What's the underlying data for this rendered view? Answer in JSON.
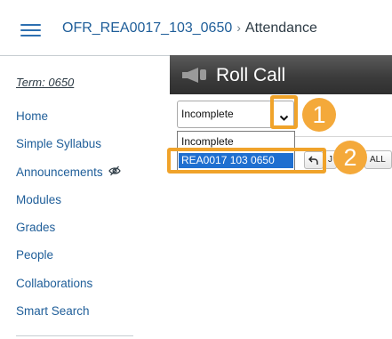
{
  "header": {
    "course_link": "OFR_REA0017_103_0650",
    "separator": "›",
    "current_page": "Attendance"
  },
  "sidebar": {
    "term": "Term: 0650",
    "items": [
      {
        "label": "Home"
      },
      {
        "label": "Simple Syllabus"
      },
      {
        "label": "Announcements"
      },
      {
        "label": "Modules"
      },
      {
        "label": "Grades"
      },
      {
        "label": "People"
      },
      {
        "label": "Collaborations"
      },
      {
        "label": "Smart Search"
      }
    ]
  },
  "roll_call": {
    "title": "Roll Call",
    "select_value": "Incomplete",
    "options": [
      "Incomplete",
      "REA0017 103 0650"
    ],
    "partial_button_1": "J",
    "partial_button_2": "ALL"
  },
  "callouts": {
    "step1": "1",
    "step2": "2",
    "color": "#f0a32a"
  },
  "colors": {
    "link": "#1f5e99",
    "header_bar": "#3c3c3c",
    "selected_option": "#1f6fd0"
  },
  "icons": {
    "menu": "hamburger-icon",
    "roll_call": "megaphone-icon",
    "hidden": "eye-slash-icon",
    "dropdown": "chevron-down-icon",
    "back": "undo-arrow-icon"
  }
}
